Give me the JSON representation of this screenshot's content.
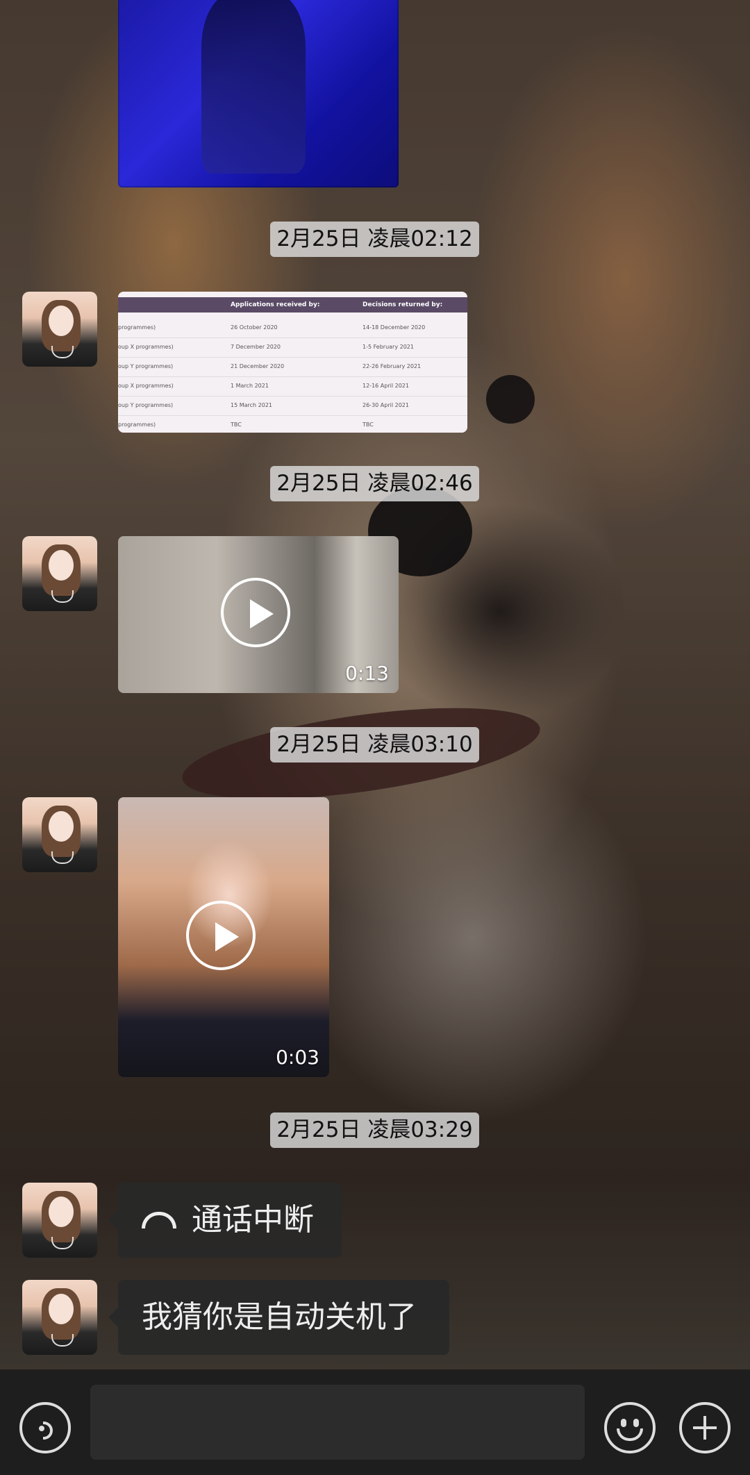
{
  "chat": {
    "timestamps": [
      "2月25日 凌晨02:12",
      "2月25日 凌晨02:46",
      "2月25日 凌晨03:10",
      "2月25日 凌晨03:29"
    ],
    "table_image": {
      "headers": [
        "Applications received by:",
        "Decisions returned by:"
      ],
      "rows": [
        {
          "group": "programmes)",
          "received": "26 October 2020",
          "decision": "14-18 December 2020"
        },
        {
          "group": "oup X programmes)",
          "received": "7 December 2020",
          "decision": "1-5 February 2021"
        },
        {
          "group": "oup Y programmes)",
          "received": "21 December 2020",
          "decision": "22-26 February 2021"
        },
        {
          "group": "oup X programmes)",
          "received": "1 March 2021",
          "decision": "12-16 April 2021"
        },
        {
          "group": "oup Y programmes)",
          "received": "15 March 2021",
          "decision": "26-30 April 2021"
        },
        {
          "group": "programmes)",
          "received": "TBC",
          "decision": "TBC"
        }
      ]
    },
    "videos": [
      {
        "duration": "0:13"
      },
      {
        "duration": "0:03"
      }
    ],
    "messages": [
      {
        "text": "通话中断",
        "icon": "phone-hangup-icon"
      },
      {
        "text": "我猜你是自动关机了"
      }
    ]
  },
  "input_bar": {
    "value": "",
    "icons": [
      "voice-icon",
      "emoji-icon",
      "plus-icon"
    ]
  }
}
